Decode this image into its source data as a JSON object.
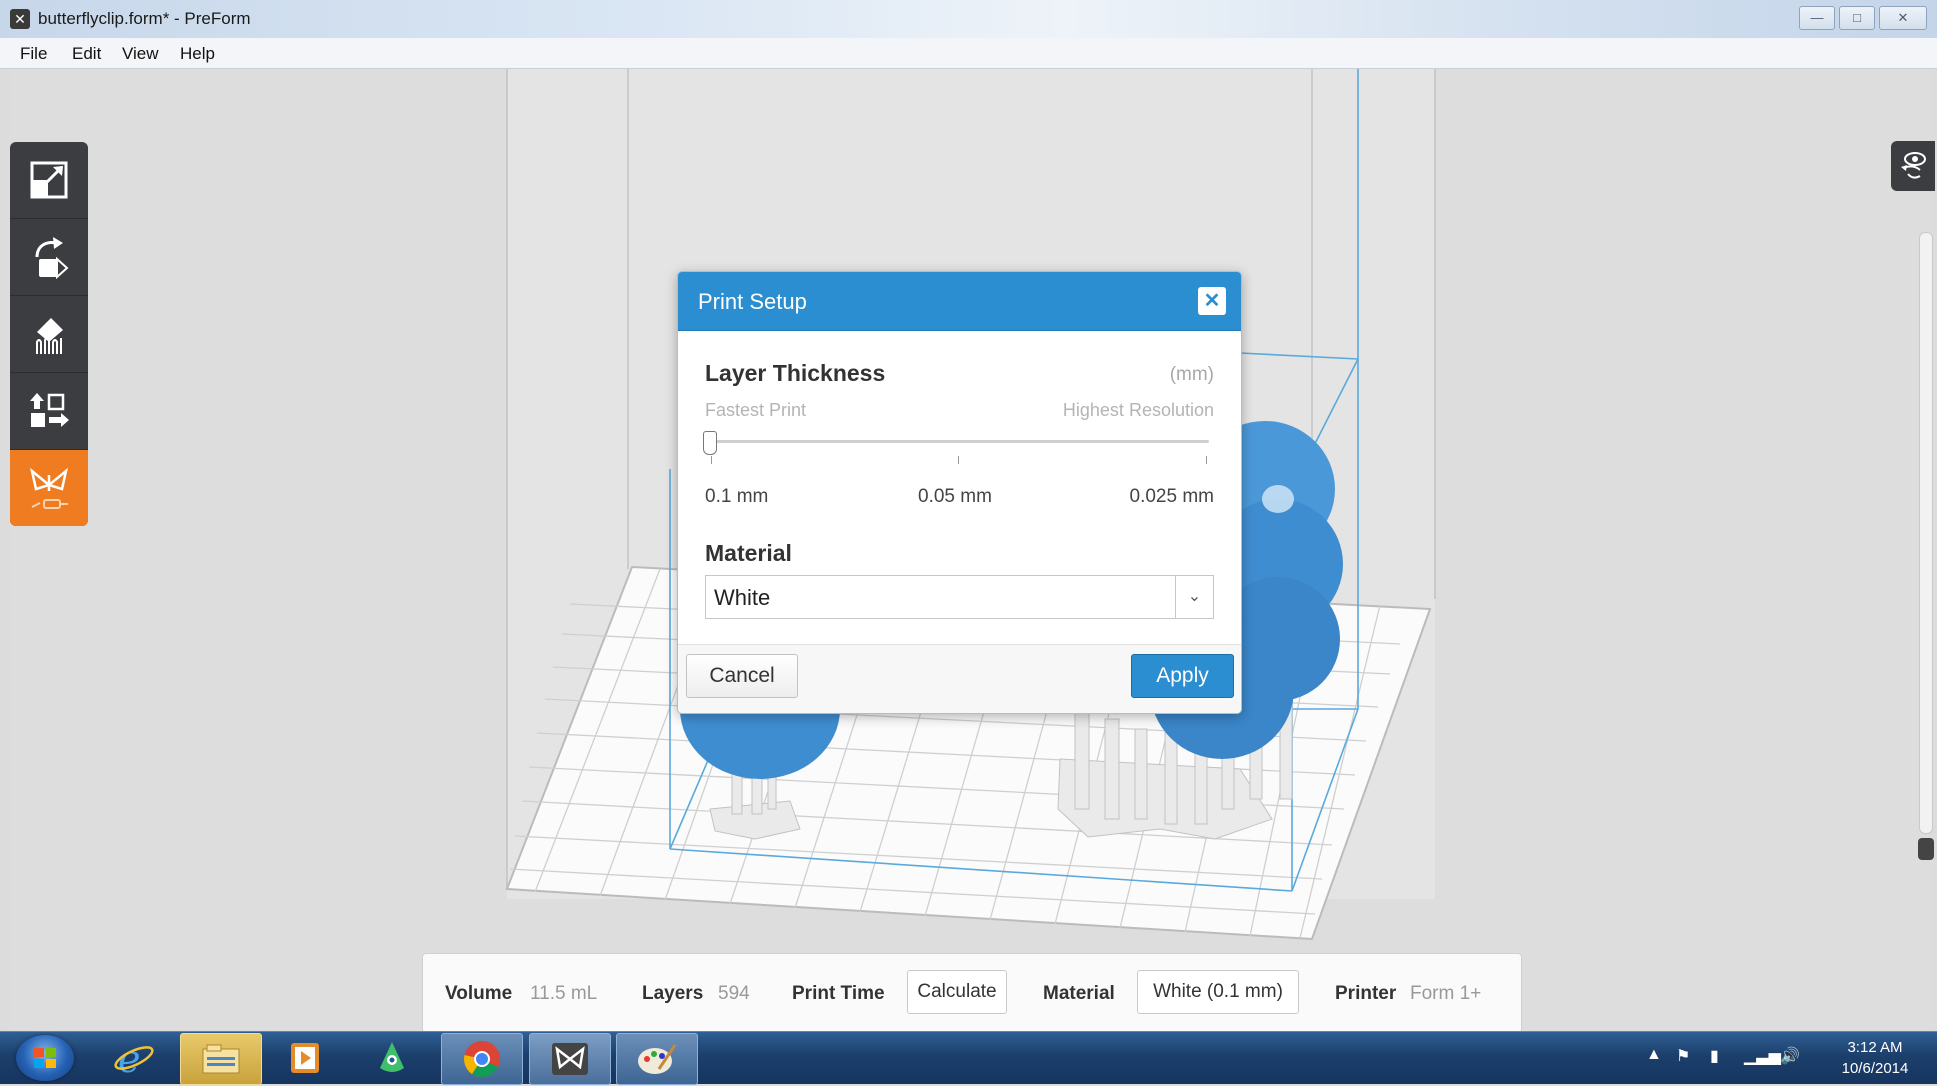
{
  "window": {
    "title": "butterflyclip.form* - PreForm",
    "controls": {
      "minimize": "—",
      "maximize": "□",
      "close": "✕"
    }
  },
  "menu": [
    "File",
    "Edit",
    "View",
    "Help"
  ],
  "toolbar": {
    "tools": [
      "scale-icon",
      "rotate-icon",
      "supports-icon",
      "layout-icon",
      "print-butterfly-icon"
    ],
    "active_tool": "print-butterfly-icon",
    "accent": "#f07c21"
  },
  "dialog": {
    "title": "Print Setup",
    "close_glyph": "✕",
    "layer_thickness": {
      "title": "Layer Thickness",
      "unit": "(mm)",
      "left_hint": "Fastest Print",
      "right_hint": "Highest Resolution",
      "ticks": [
        "0.1 mm",
        "0.05 mm",
        "0.025 mm"
      ],
      "selected_index": 0
    },
    "material": {
      "title": "Material",
      "value": "White"
    },
    "cancel_label": "Cancel",
    "apply_label": "Apply",
    "accent": "#2a8ed0"
  },
  "info_bar": {
    "volume_label": "Volume",
    "volume_value": "11.5 mL",
    "layers_label": "Layers",
    "layers_value": "594",
    "print_time_label": "Print Time",
    "calculate_label": "Calculate",
    "material_label": "Material",
    "material_value": "White (0.1 mm)",
    "printer_label": "Printer",
    "printer_value": "Form 1+"
  },
  "taskbar": {
    "apps": [
      "internet-explorer-icon",
      "file-explorer-icon",
      "media-player-icon",
      "app-icon",
      "chrome-icon",
      "preform-icon",
      "paint-icon"
    ],
    "clock_time": "3:12 AM",
    "clock_date": "10/6/2014"
  }
}
